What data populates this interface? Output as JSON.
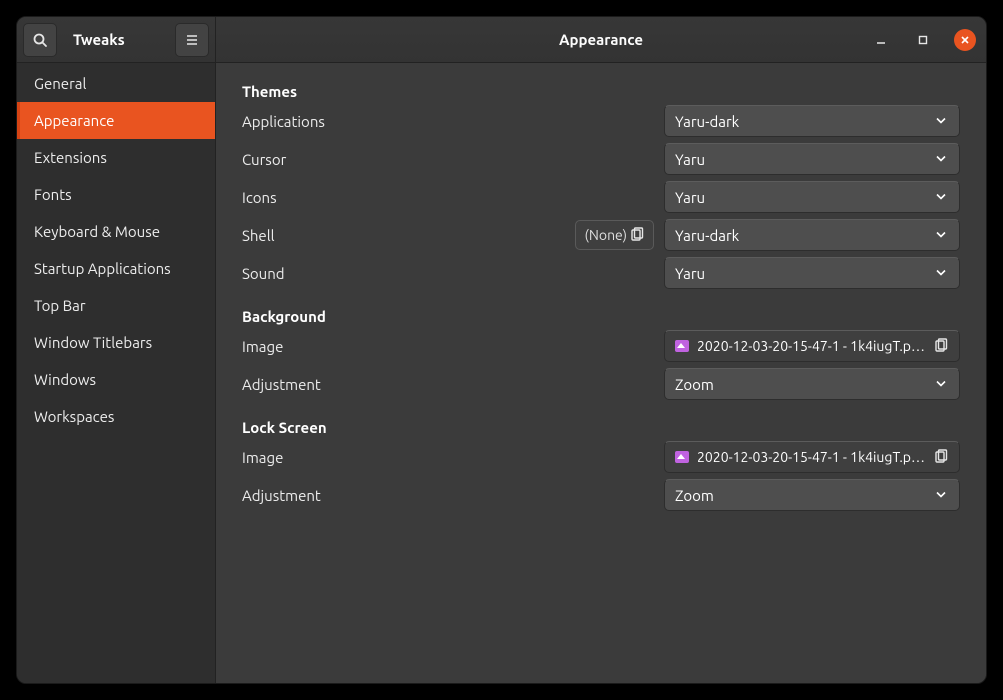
{
  "app_title": "Tweaks",
  "page_title": "Appearance",
  "sidebar": {
    "items": [
      {
        "label": "General"
      },
      {
        "label": "Appearance"
      },
      {
        "label": "Extensions"
      },
      {
        "label": "Fonts"
      },
      {
        "label": "Keyboard & Mouse"
      },
      {
        "label": "Startup Applications"
      },
      {
        "label": "Top Bar"
      },
      {
        "label": "Window Titlebars"
      },
      {
        "label": "Windows"
      },
      {
        "label": "Workspaces"
      }
    ],
    "active_index": 1
  },
  "themes": {
    "section_label": "Themes",
    "applications": {
      "label": "Applications",
      "value": "Yaru-dark"
    },
    "cursor": {
      "label": "Cursor",
      "value": "Yaru"
    },
    "icons": {
      "label": "Icons",
      "value": "Yaru"
    },
    "shell": {
      "label": "Shell",
      "aux": "(None)",
      "value": "Yaru-dark"
    },
    "sound": {
      "label": "Sound",
      "value": "Yaru"
    }
  },
  "background": {
    "section_label": "Background",
    "image": {
      "label": "Image",
      "value": "2020-12-03-20-15-47-1 - 1k4iugT.png"
    },
    "adjustment": {
      "label": "Adjustment",
      "value": "Zoom"
    }
  },
  "lockscreen": {
    "section_label": "Lock Screen",
    "image": {
      "label": "Image",
      "value": "2020-12-03-20-15-47-1 - 1k4iugT.png"
    },
    "adjustment": {
      "label": "Adjustment",
      "value": "Zoom"
    }
  }
}
